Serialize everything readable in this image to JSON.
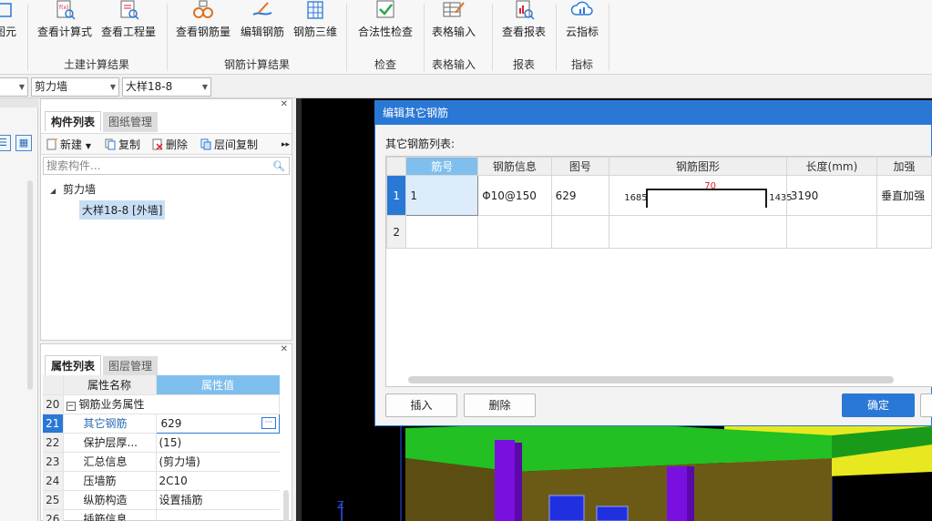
{
  "ribbon": {
    "buttons": [
      {
        "label": "图元",
        "icon": "element-icon"
      },
      {
        "label": "查看计算式",
        "icon": "view-formula-icon"
      },
      {
        "label": "查看工程量",
        "icon": "view-quantity-icon"
      },
      {
        "label": "查看钢筋量",
        "icon": "view-rebar-quantity-icon"
      },
      {
        "label": "编辑钢筋",
        "icon": "edit-rebar-icon"
      },
      {
        "label": "钢筋三维",
        "icon": "rebar-3d-icon"
      },
      {
        "label": "合法性检查",
        "icon": "validity-check-icon"
      },
      {
        "label": "表格输入",
        "icon": "table-input-icon"
      },
      {
        "label": "查看报表",
        "icon": "view-report-icon"
      },
      {
        "label": "云指标",
        "icon": "cloud-index-icon"
      }
    ],
    "groups": [
      "土建计算结果",
      "钢筋计算结果",
      "检查",
      "表格输入",
      "报表",
      "指标"
    ]
  },
  "combos": {
    "first": "",
    "second": "剪力墙",
    "third": "大样18-8"
  },
  "component_panel": {
    "tabs": [
      "构件列表",
      "图纸管理"
    ],
    "toolbar": {
      "new": "新建",
      "copy": "复制",
      "delete": "删除",
      "floor_copy": "层间复制"
    },
    "search_placeholder": "搜索构件...",
    "tree": {
      "root": "剪力墙",
      "child": "大样18-8 [外墙]"
    }
  },
  "property_panel": {
    "tabs": [
      "属性列表",
      "图层管理"
    ],
    "headers": {
      "name": "属性名称",
      "value": "属性值"
    },
    "rows": [
      {
        "num": "20",
        "name": "钢筋业务属性",
        "value": ""
      },
      {
        "num": "21",
        "name": "其它钢筋",
        "value": "629"
      },
      {
        "num": "22",
        "name": "保护层厚...",
        "value": "(15)"
      },
      {
        "num": "23",
        "name": "汇总信息",
        "value": "(剪力墙)"
      },
      {
        "num": "24",
        "name": "压墙筋",
        "value": "2C10"
      },
      {
        "num": "25",
        "name": "纵筋构造",
        "value": "设置插筋"
      },
      {
        "num": "26",
        "name": "插筋信息",
        "value": ""
      }
    ]
  },
  "dialog": {
    "title": "编辑其它钢筋",
    "caption": "其它钢筋列表:",
    "headers": [
      "筋号",
      "钢筋信息",
      "图号",
      "钢筋图形",
      "长度(mm)",
      "加强"
    ],
    "rows": [
      {
        "num": "1",
        "bar_no": "1",
        "info": "Φ10@150",
        "shape_no": "629",
        "dim_left": "1685",
        "dim_mid": "70",
        "dim_right": "1435",
        "length": "3190",
        "extra": "垂直加强"
      },
      {
        "num": "2",
        "bar_no": "",
        "info": "",
        "shape_no": "",
        "dim_left": "",
        "dim_mid": "",
        "dim_right": "",
        "length": "",
        "extra": ""
      }
    ],
    "buttons": {
      "insert": "插入",
      "delete": "删除",
      "ok": "确定"
    }
  },
  "viewport": {
    "axis_label": "Z"
  },
  "colors": {
    "accent": "#2a78d6",
    "header_blue": "#7fbfee",
    "wall_olive": "#6b5a16",
    "slab_green": "#22c022",
    "column_purple": "#7a10e0",
    "slab_yellow": "#e8e820"
  }
}
